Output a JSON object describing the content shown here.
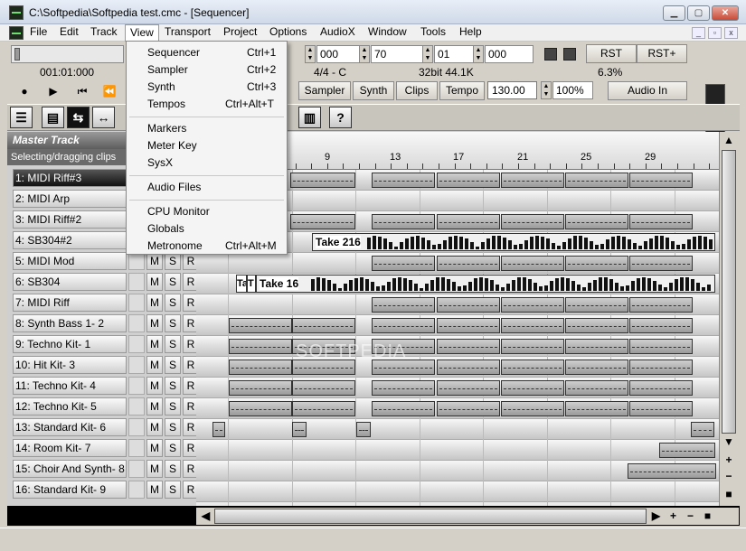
{
  "window": {
    "title": "C:\\Softpedia\\Softpedia test.cmc - [Sequencer]"
  },
  "menu": [
    "File",
    "Edit",
    "Track",
    "View",
    "Transport",
    "Project",
    "Options",
    "AudioX",
    "Window",
    "Tools",
    "Help"
  ],
  "view_menu": [
    {
      "label": "Sequencer",
      "shortcut": "Ctrl+1"
    },
    {
      "label": "Sampler",
      "shortcut": "Ctrl+2"
    },
    {
      "label": "Synth",
      "shortcut": "Ctrl+3"
    },
    {
      "label": "Tempos",
      "shortcut": "Ctrl+Alt+T"
    },
    {
      "label": "Markers",
      "shortcut": ""
    },
    {
      "label": "Meter Key",
      "shortcut": ""
    },
    {
      "label": "SysX",
      "shortcut": ""
    },
    {
      "label": "Audio Files",
      "shortcut": ""
    },
    {
      "label": "CPU Monitor",
      "shortcut": ""
    },
    {
      "label": "Globals",
      "shortcut": ""
    },
    {
      "label": "Metronome",
      "shortcut": "Ctrl+Alt+M"
    }
  ],
  "toolbar": {
    "position": "001:01:000",
    "spin_000a": "000",
    "spin_70": "70",
    "spin_01": "01",
    "spin_000b": "000",
    "meter": "4/4 - C",
    "format": "32bit 44.1K",
    "cpu": "6.3%",
    "rst": "RST",
    "rst_plus": "RST+",
    "sampler": "Sampler",
    "synth": "Synth",
    "clips": "Clips",
    "tempo_label": "Tempo",
    "tempo_value": "130.00",
    "zoom_value": "100%",
    "audio_in": "Audio In",
    "help_icon": "?"
  },
  "tracks": {
    "master": "Master Track",
    "status": "Selecting/dragging clips",
    "list": [
      "1: MIDI Riff#3",
      "2: MIDI Arp",
      "3: MIDI Riff#2",
      "4: SB304#2",
      "5: MIDI Mod",
      "6: SB304",
      "7: MIDI Riff",
      "8: Synth Bass 1- 2",
      "9: Techno Kit- 1",
      "10: Hit Kit- 3",
      "11: Techno Kit- 4",
      "12: Techno Kit- 5",
      "13: Standard Kit- 6",
      "14: Room Kit- 7",
      "15: Choir And Synth- 8",
      "16: Standard Kit- 9"
    ],
    "m": "M",
    "s": "S",
    "r": "R"
  },
  "ruler": {
    "bars": [
      "9",
      "13",
      "17",
      "21",
      "25",
      "29"
    ]
  },
  "clips": {
    "take216": "Take 216",
    "take16": "Take 16",
    "t1": "Ta",
    "t2": "T"
  },
  "watermark": "SOFTPEDIA"
}
